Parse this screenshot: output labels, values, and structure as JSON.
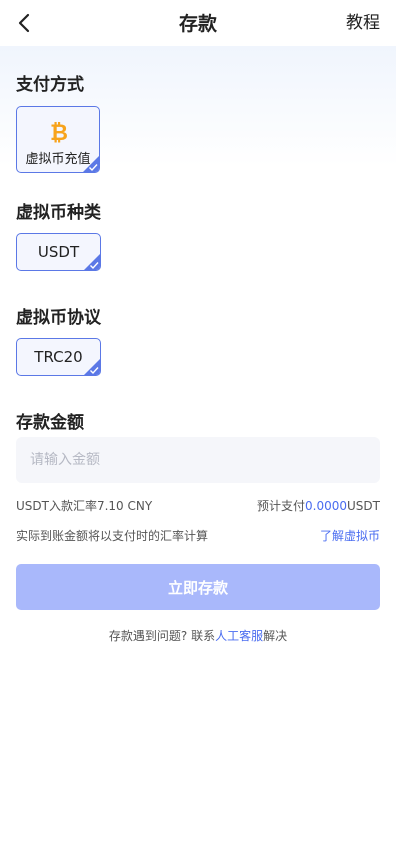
{
  "header": {
    "title": "存款",
    "tutorial_label": "教程"
  },
  "payment_method": {
    "section_title": "支付方式",
    "selected_label": "虚拟币充值"
  },
  "coin_type": {
    "section_title": "虚拟币种类",
    "selected": "USDT"
  },
  "protocol": {
    "section_title": "虚拟币协议",
    "selected": "TRC20"
  },
  "amount": {
    "section_title": "存款金额",
    "placeholder": "请输入金额",
    "value": ""
  },
  "rate": {
    "rate_text": "USDT入款汇率7.10 CNY",
    "estimate_prefix": "预计支付",
    "estimate_value": "0.0000",
    "estimate_unit": "USDT"
  },
  "notice": {
    "text": "实际到账金额将以支付时的汇率计算",
    "learn_link": "了解虚拟币"
  },
  "submit_label": "立即存款",
  "help": {
    "question": "存款遇到问题?",
    "contact_prefix": "联系",
    "contact_link": "人工客服",
    "contact_suffix": "解决"
  },
  "colors": {
    "accent": "#4a6cf0",
    "selected_border": "#5b78e6",
    "submit_disabled": "#a9b8fb",
    "bitcoin": "#f7a31c"
  }
}
